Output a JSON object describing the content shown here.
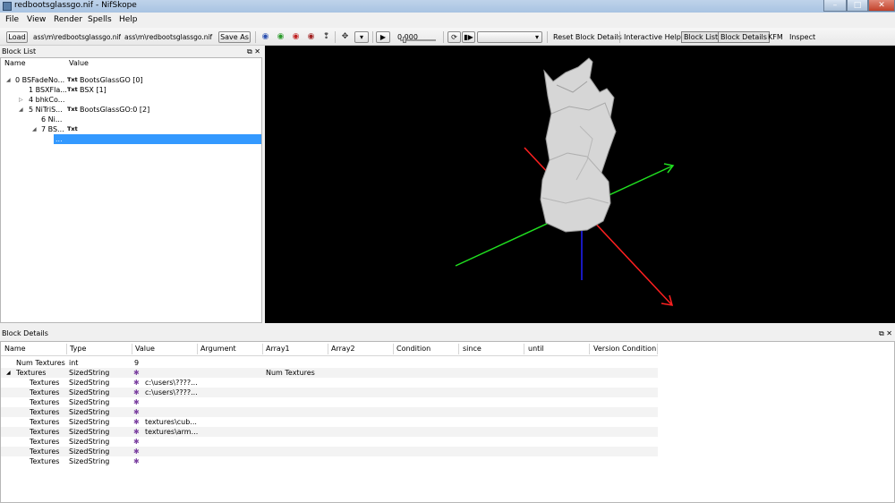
{
  "window": {
    "title": "redbootsglassgo.nif - NifSkope",
    "buttons": {
      "minimize": "–",
      "maximize": "□",
      "close": "✕"
    }
  },
  "menu": [
    "File",
    "View",
    "Render",
    "Spells",
    "Help"
  ],
  "toolbar": {
    "load_label": "Load",
    "load_path": "ass\\m\\redbootsglassgo.nif",
    "save_path": "ass\\m\\redbootsglassgo.nif",
    "save_as_label": "Save As",
    "time_value": "0.000",
    "reset_block_details": "Reset Block Details",
    "interactive_help": "Interactive Help",
    "block_list": "Block List",
    "block_details": "Block Details",
    "kfm": "KFM",
    "inspect": "Inspect"
  },
  "block_list": {
    "title": "Block List",
    "dock_buttons": "⧉ ✕",
    "columns": {
      "name": "Name",
      "value": "Value"
    },
    "rows": [
      {
        "toggle": "◢",
        "name": "0 BSFadeNo...",
        "type": "Txt",
        "value": "BootsGlassGO [0]"
      },
      {
        "toggle": "",
        "name": "1 BSXFla...",
        "type": "Txt",
        "value": "BSX [1]"
      },
      {
        "toggle": "▷",
        "name": "4 bhkCo...",
        "type": "",
        "value": ""
      },
      {
        "toggle": "◢",
        "name": "5 NiTriS...",
        "type": "Txt",
        "value": "BootsGlassGO:0 [2]"
      },
      {
        "toggle": "",
        "name": "6 Ni...",
        "type": "",
        "value": ""
      },
      {
        "toggle": "◢",
        "name": "7 BS...",
        "type": "Txt",
        "value": ""
      },
      {
        "toggle": "",
        "name": "...",
        "type": "",
        "value": ""
      }
    ]
  },
  "block_details": {
    "title": "Block Details",
    "dock_buttons": "⧉ ✕",
    "columns": [
      "Name",
      "Type",
      "Value",
      "Argument",
      "Array1",
      "Array2",
      "Condition",
      "since",
      "until",
      "Version Condition"
    ],
    "rows": [
      {
        "toggle": "",
        "name": "Num Textures",
        "type": "int",
        "icon": "",
        "value": "9",
        "array1": ""
      },
      {
        "toggle": "◢",
        "name": "Textures",
        "type": "SizedString",
        "icon": "✱",
        "value": "",
        "array1": "Num Textures"
      },
      {
        "toggle": "",
        "name": "Textures",
        "type": "SizedString",
        "icon": "✱",
        "value": "c:\\users\\????...",
        "array1": ""
      },
      {
        "toggle": "",
        "name": "Textures",
        "type": "SizedString",
        "icon": "✱",
        "value": "c:\\users\\????...",
        "array1": ""
      },
      {
        "toggle": "",
        "name": "Textures",
        "type": "SizedString",
        "icon": "✱",
        "value": "",
        "array1": ""
      },
      {
        "toggle": "",
        "name": "Textures",
        "type": "SizedString",
        "icon": "✱",
        "value": "",
        "array1": ""
      },
      {
        "toggle": "",
        "name": "Textures",
        "type": "SizedString",
        "icon": "✱",
        "value": "textures\\cub...",
        "array1": ""
      },
      {
        "toggle": "",
        "name": "Textures",
        "type": "SizedString",
        "icon": "✱",
        "value": "textures\\arm...",
        "array1": ""
      },
      {
        "toggle": "",
        "name": "Textures",
        "type": "SizedString",
        "icon": "✱",
        "value": "",
        "array1": ""
      },
      {
        "toggle": "",
        "name": "Textures",
        "type": "SizedString",
        "icon": "✱",
        "value": "",
        "array1": ""
      },
      {
        "toggle": "",
        "name": "Textures",
        "type": "SizedString",
        "icon": "✱",
        "value": "",
        "array1": ""
      }
    ]
  },
  "colors": {
    "selection": "#3399ff",
    "axis_x": "#ff2020",
    "axis_y": "#20e020",
    "axis_z": "#2020ff",
    "viewport_bg": "#000000",
    "mesh": "#d8d8d8"
  },
  "icons": [
    "app-icon",
    "eye-icons",
    "play-icon",
    "loop-icon",
    "texture-icon"
  ]
}
